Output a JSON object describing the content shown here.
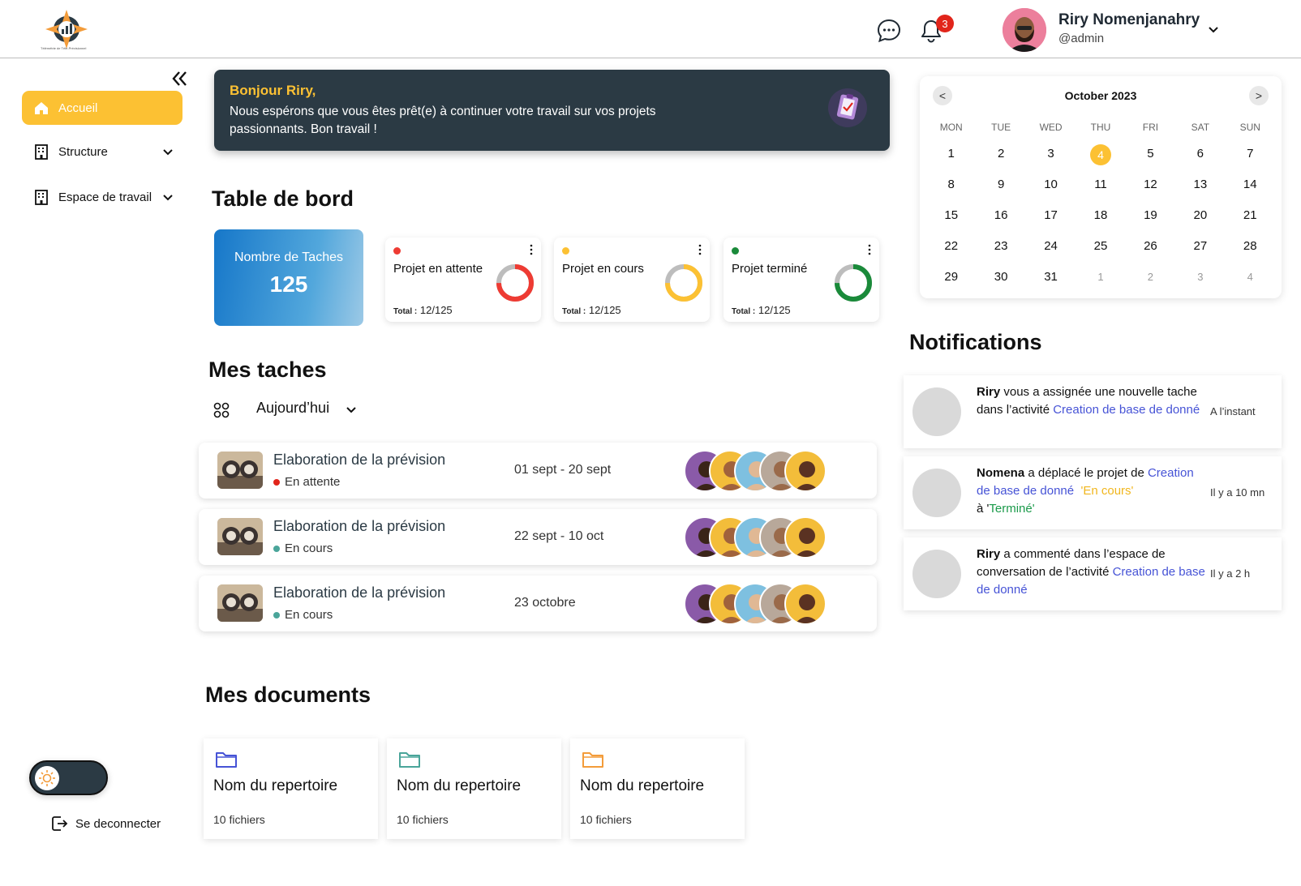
{
  "app": {
    "logo_caption": "Télémétrie de Télé-Prévisionnel"
  },
  "header": {
    "notification_count": "3",
    "user_name": "Riry Nomenjanahry",
    "user_handle": "@admin"
  },
  "sidebar": {
    "items": [
      {
        "label": "Accueil",
        "icon": "home-icon",
        "active": true
      },
      {
        "label": "Structure",
        "icon": "building-icon"
      },
      {
        "label": "Espace de travail",
        "icon": "building-icon"
      }
    ],
    "logout_label": "Se deconnecter",
    "theme": "light"
  },
  "banner": {
    "title": "Bonjour Riry,",
    "text": "Nous espérons que vous êtes prêt(e) à continuer votre travail sur vos projets passionnants. Bon travail !"
  },
  "dashboard": {
    "title": "Table de bord",
    "total_label": "Nombre de Taches",
    "total_value": "125",
    "cards": [
      {
        "label": "Projet en attente",
        "total_prefix": "Total :",
        "total": "12/125",
        "color": "#ee3b33"
      },
      {
        "label": "Projet en cours",
        "total_prefix": "Total :",
        "total": "12/125",
        "color": "#fcc133"
      },
      {
        "label": "Projet terminé",
        "total_prefix": "Total :",
        "total": "12/125",
        "color": "#1a8a3a"
      }
    ]
  },
  "tasks": {
    "title": "Mes taches",
    "filter": "Aujourd’hui",
    "rows": [
      {
        "name": "Elaboration de la prévision",
        "status": "En attente",
        "status_color": "#e1251b",
        "date": "01 sept - 20 sept"
      },
      {
        "name": "Elaboration de la prévision",
        "status": "En cours",
        "status_color": "#4aa59a",
        "date": "22 sept - 10 oct"
      },
      {
        "name": "Elaboration de la prévision",
        "status": "En cours",
        "status_color": "#4aa59a",
        "date": "23 octobre"
      }
    ]
  },
  "documents": {
    "title": "Mes documents",
    "items": [
      {
        "name": "Nom du repertoire",
        "count": "10 fichiers",
        "color": "#4653d6"
      },
      {
        "name": "Nom du repertoire",
        "count": "10 fichiers",
        "color": "#4aa59a"
      },
      {
        "name": "Nom du repertoire",
        "count": "10 fichiers",
        "color": "#f39c3a"
      }
    ]
  },
  "calendar": {
    "month": "October 2023",
    "prev": "<",
    "next": ">",
    "weekdays": [
      "MON",
      "TUE",
      "WED",
      "THU",
      "FRI",
      "SAT",
      "SUN"
    ],
    "weeks": [
      [
        "1",
        "2",
        "3",
        "4",
        "5",
        "6",
        "7"
      ],
      [
        "8",
        "9",
        "10",
        "11",
        "12",
        "13",
        "14"
      ],
      [
        "15",
        "16",
        "17",
        "18",
        "19",
        "20",
        "21"
      ],
      [
        "22",
        "23",
        "24",
        "25",
        "26",
        "27",
        "28"
      ],
      [
        "29",
        "30",
        "31",
        "1",
        "2",
        "3",
        "4"
      ]
    ],
    "today": "4"
  },
  "notifications": {
    "title": "Notifications",
    "items": [
      {
        "actor": "Riry",
        "text_1": " vous a assignée une nouvelle tache dans l’activité ",
        "link": "Creation de base de donné",
        "time": "A l’instant"
      },
      {
        "actor": "Nomena",
        "text_1": "  a déplacé le projet  de ",
        "link": "Creation de base de donné",
        "from_status": "'En cours'",
        "to_prefix": "à '",
        "to_status": "Terminé",
        "time": "Il y a 10 mn"
      },
      {
        "actor": "Riry",
        "text_1": " a commenté dans l’espace de conversation de  l’activité ",
        "link": "Creation de base de donné",
        "time": "Il y a 2 h"
      }
    ]
  },
  "colors": {
    "accent": "#fcc133",
    "dark": "#2b3a44",
    "link": "#4653d6"
  }
}
